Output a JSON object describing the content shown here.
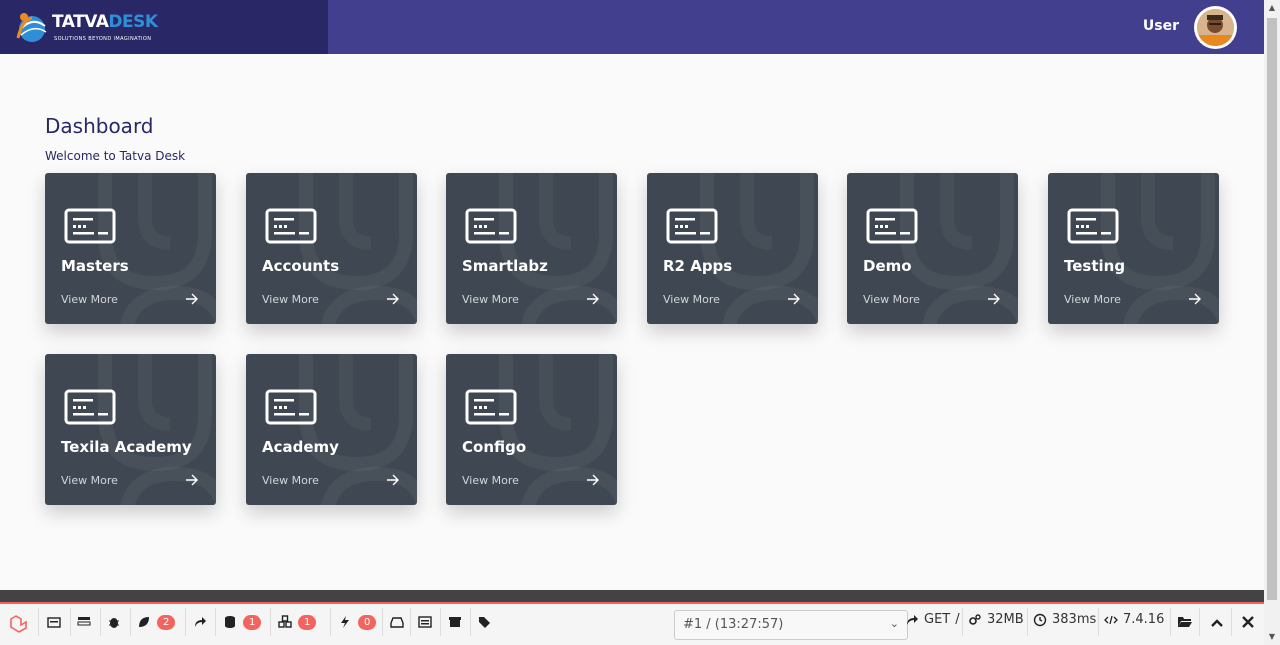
{
  "header": {
    "logo_part1": "TATVA",
    "logo_part2": "DESK",
    "logo_tagline": "SOLUTIONS BEYOND IMAGINATION",
    "user_name": "User",
    "colors": {
      "header_bg": "#433f8f",
      "logo_bg": "#2a2766"
    }
  },
  "main": {
    "title": "Dashboard",
    "subtitle": "Welcome to Tatva Desk",
    "cards": [
      {
        "title": "Masters",
        "link": "View More",
        "icon": "id-card-icon"
      },
      {
        "title": "Accounts",
        "link": "View More",
        "icon": "id-card-icon"
      },
      {
        "title": "Smartlabz",
        "link": "View More",
        "icon": "id-card-icon"
      },
      {
        "title": "R2 Apps",
        "link": "View More",
        "icon": "id-card-icon"
      },
      {
        "title": "Demo",
        "link": "View More",
        "icon": "id-card-icon"
      },
      {
        "title": "Testing",
        "link": "View More",
        "icon": "id-card-icon"
      },
      {
        "title": "Texila Academy",
        "link": "View More",
        "icon": "id-card-icon"
      },
      {
        "title": "Academy",
        "link": "View More",
        "icon": "id-card-icon"
      },
      {
        "title": "Configo",
        "link": "View More",
        "icon": "id-card-icon"
      }
    ],
    "card_color": "#3f4752"
  },
  "debugbar": {
    "badges": {
      "messages": "2",
      "queries": "1",
      "models": "1",
      "events": "0"
    },
    "request_select": "#1 / (13:27:57)",
    "method": "GET",
    "route": "/",
    "memory": "32MB",
    "time": "383ms",
    "php_version": "7.4.16",
    "accent": "#f4645f"
  }
}
